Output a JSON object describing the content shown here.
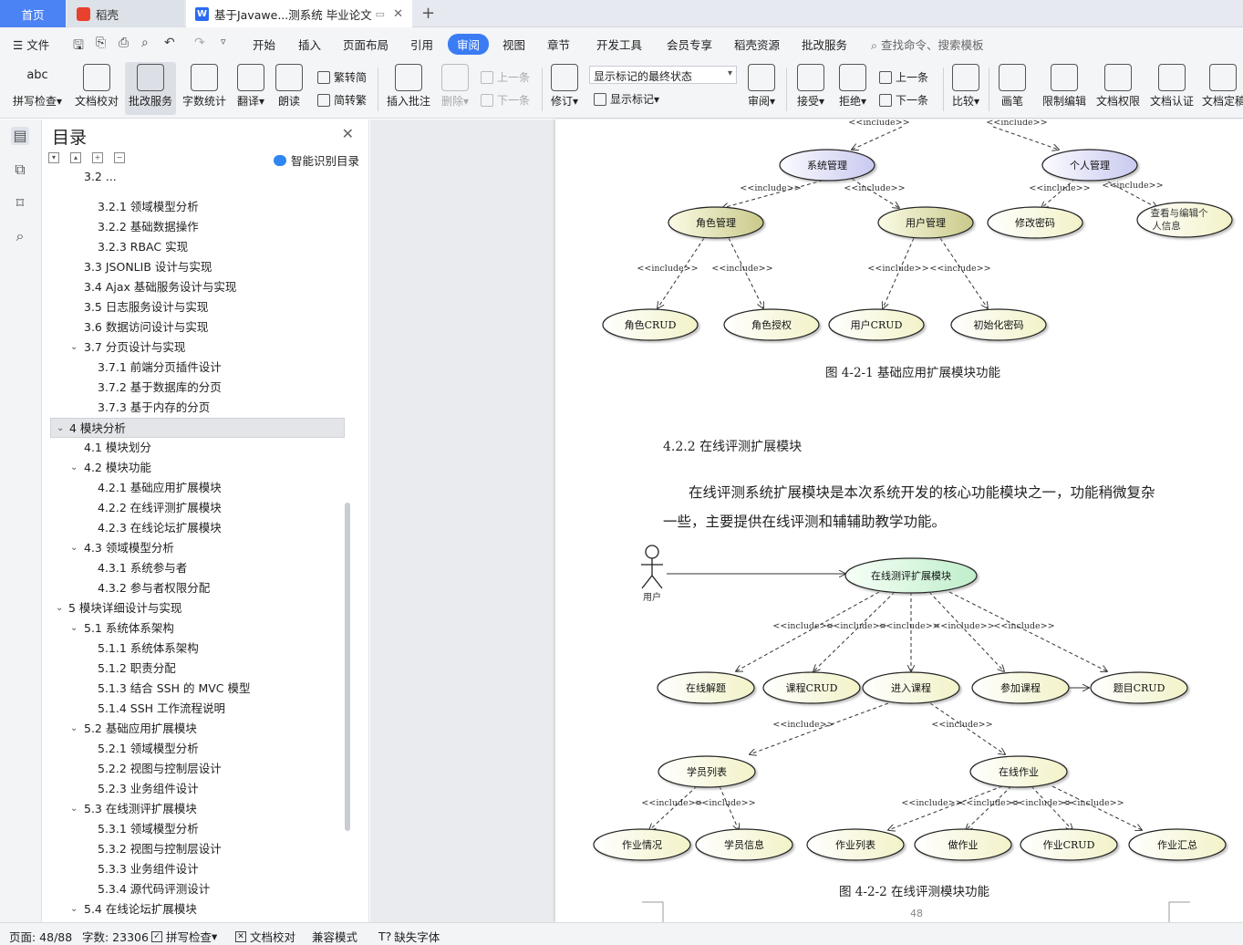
{
  "tabs": {
    "home": "首页",
    "daoke": "稻壳",
    "doc": "基于Javawe...测系统 毕业论文"
  },
  "menu": {
    "file": "文件",
    "items": [
      "开始",
      "插入",
      "页面布局",
      "引用",
      "审阅",
      "视图",
      "章节",
      "开发工具",
      "会员专享",
      "稻壳资源",
      "批改服务"
    ],
    "active": "审阅",
    "search": "查找命令、搜索模板"
  },
  "ribbon": {
    "spell": "拼写检查",
    "doc_proof": "文档校对",
    "correct_service": "批改服务",
    "word_count": "字数统计",
    "translate": "翻译",
    "read_aloud": "朗读",
    "trad": "繁转简",
    "simp": "简转繁",
    "insert_comment": "插入批注",
    "delete": "删除",
    "prev": "上一条",
    "next": "下一条",
    "revise": "修订",
    "markup_state": "显示标记的最终状态",
    "show_markup": "显示标记",
    "review": "审阅",
    "accept": "接受",
    "reject": "拒绝",
    "prev2": "上一条",
    "next2": "下一条",
    "compare": "比较",
    "pen": "画笔",
    "restrict_edit": "限制编辑",
    "doc_perm": "文档权限",
    "doc_cert": "文档认证",
    "doc_final": "文档定稿"
  },
  "toc": {
    "title": "目录",
    "smart": "智能识别目录",
    "items": [
      {
        "t": "3.2  ...",
        "l": 2
      },
      {
        "t": "3.2.1  领域模型分析",
        "l": 3
      },
      {
        "t": "3.2.2  基础数据操作",
        "l": 3
      },
      {
        "t": "3.2.3  RBAC 实现",
        "l": 3
      },
      {
        "t": "3.3  JSONLIB 设计与实现",
        "l": 2
      },
      {
        "t": "3.4  Ajax 基础服务设计与实现",
        "l": 2
      },
      {
        "t": "3.5  日志服务设计与实现",
        "l": 2
      },
      {
        "t": "3.6  数据访问设计与实现",
        "l": 2
      },
      {
        "t": "3.7  分页设计与实现",
        "l": 2,
        "c": 1
      },
      {
        "t": "3.7.1  前端分页插件设计",
        "l": 3
      },
      {
        "t": "3.7.2  基于数据库的分页",
        "l": 3
      },
      {
        "t": "3.7.3  基于内存的分页",
        "l": 3
      },
      {
        "t": "4  模块分析",
        "l": 1,
        "c": 1,
        "sel": 1
      },
      {
        "t": "4.1  模块划分",
        "l": 2
      },
      {
        "t": "4.2  模块功能",
        "l": 2,
        "c": 1
      },
      {
        "t": "4.2.1  基础应用扩展模块",
        "l": 3
      },
      {
        "t": "4.2.2  在线评测扩展模块",
        "l": 3
      },
      {
        "t": "4.2.3  在线论坛扩展模块",
        "l": 3
      },
      {
        "t": "4.3  领域模型分析",
        "l": 2,
        "c": 1
      },
      {
        "t": "4.3.1  系统参与者",
        "l": 3
      },
      {
        "t": "4.3.2  参与者权限分配",
        "l": 3
      },
      {
        "t": "5  模块详细设计与实现",
        "l": 1,
        "c": 1
      },
      {
        "t": "5.1  系统体系架构",
        "l": 2,
        "c": 1
      },
      {
        "t": "5.1.1  系统体系架构",
        "l": 3
      },
      {
        "t": "5.1.2  职责分配",
        "l": 3
      },
      {
        "t": "5.1.3  结合 SSH 的 MVC 模型",
        "l": 3
      },
      {
        "t": "5.1.4  SSH 工作流程说明",
        "l": 3
      },
      {
        "t": "5.2  基础应用扩展模块",
        "l": 2,
        "c": 1
      },
      {
        "t": "5.2.1  领域模型分析",
        "l": 3
      },
      {
        "t": "5.2.2  视图与控制层设计",
        "l": 3
      },
      {
        "t": "5.2.3  业务组件设计",
        "l": 3
      },
      {
        "t": "5.3  在线测评扩展模块",
        "l": 2,
        "c": 1
      },
      {
        "t": "5.3.1  领域模型分析",
        "l": 3
      },
      {
        "t": "5.3.2  视图与控制层设计",
        "l": 3
      },
      {
        "t": "5.3.3  业务组件设计",
        "l": 3
      },
      {
        "t": "5.3.4  源代码评测设计",
        "l": 3
      },
      {
        "t": "5.4  在线论坛扩展模块",
        "l": 2,
        "c": 1
      }
    ]
  },
  "doc": {
    "fig1_caption": "图  4-2-1  基础应用扩展模块功能",
    "section": "4.2.2  在线评测扩展模块",
    "para1": "在线评测系统扩展模块是本次系统开发的核心功能模块之一，功能稍微复杂",
    "para2": "一些，主要提供在线评测和辅辅助教学功能。",
    "fig2_caption": "图  4-2-2  在线评测模块功能",
    "page_num": "48",
    "include": "<<include>>",
    "actor": "用户",
    "n1": {
      "sys": "系统管理",
      "personal": "个人管理",
      "role": "角色管理",
      "user": "用户管理",
      "chpwd": "修改密码",
      "view1": "查看与编辑个",
      "view2": "人信息",
      "rolecrud": "角色CRUD",
      "roleauth": "角色授权",
      "usercrud": "用户CRUD",
      "initpwd": "初始化密码"
    },
    "n2": {
      "root": "在线测评扩展模块",
      "solve": "在线解题",
      "course": "课程CRUD",
      "enter": "进入课程",
      "join": "参加课程",
      "q": "题目CRUD",
      "students": "学员列表",
      "hw": "在线作业",
      "hwstat": "作业情况",
      "stinfo": "学员信息",
      "hwlist": "作业列表",
      "dohw": "做作业",
      "hwcrud": "作业CRUD",
      "hwsum": "作业汇总"
    }
  },
  "status": {
    "page": "页面: 48/88",
    "words": "字数: 23306",
    "spell": "拼写检查",
    "proof": "文档校对",
    "compat": "兼容模式",
    "missing_font": "缺失字体"
  }
}
